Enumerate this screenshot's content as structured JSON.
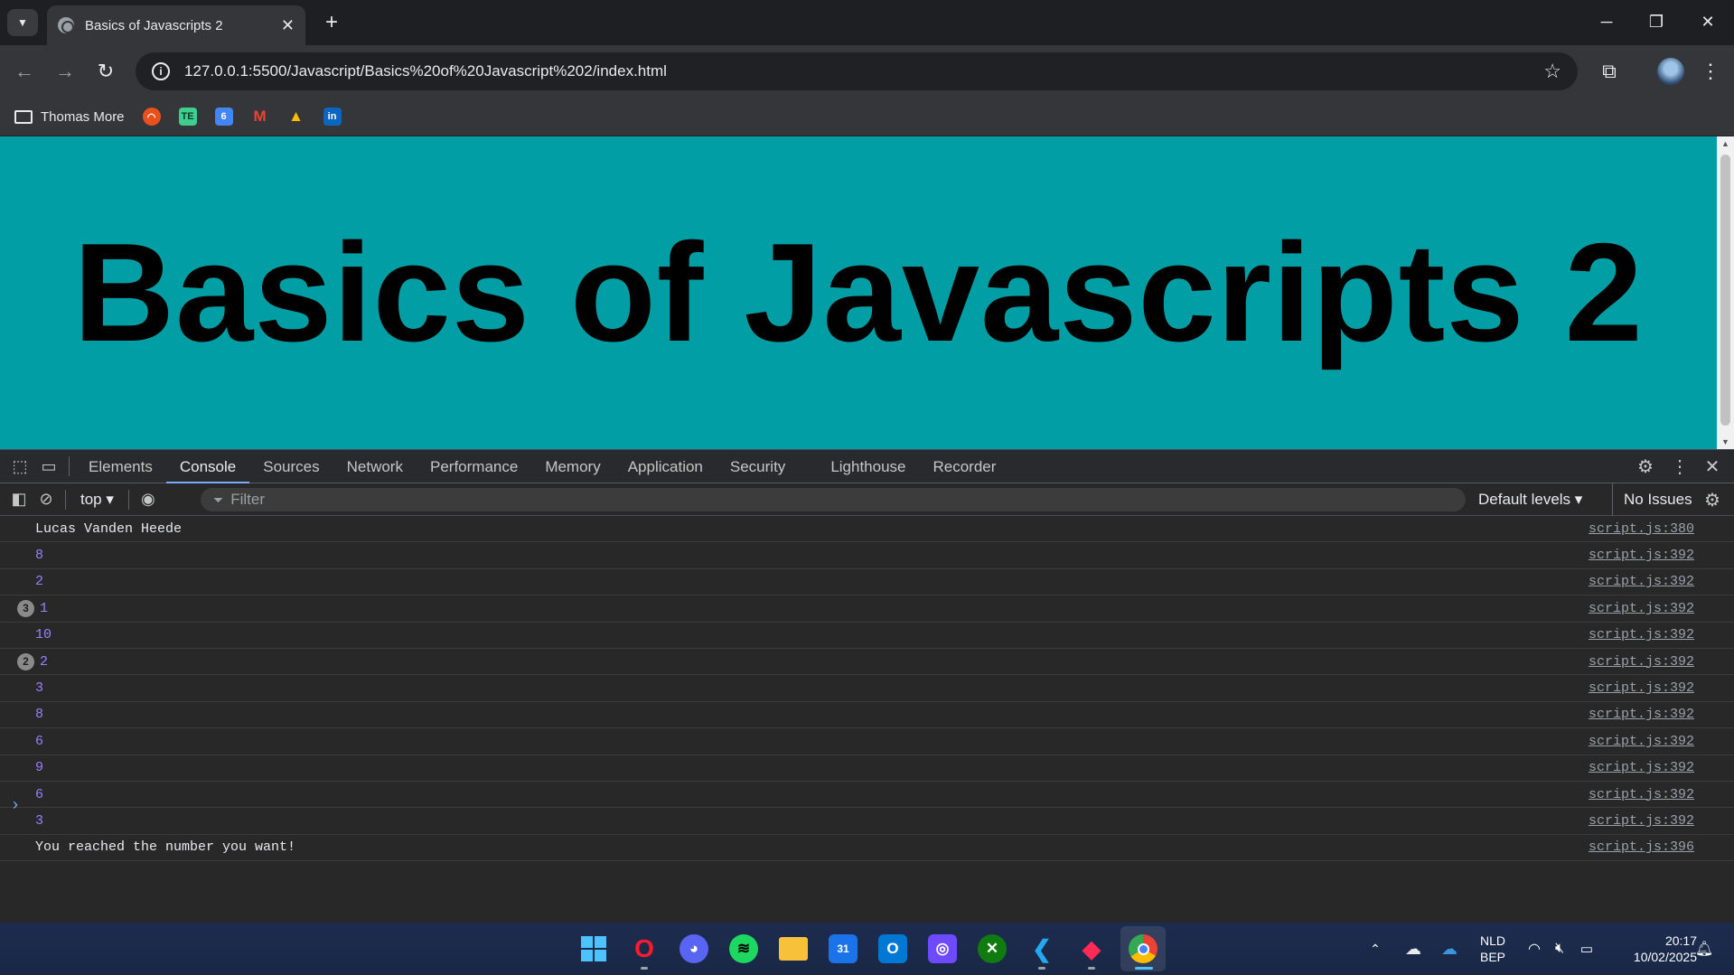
{
  "browser": {
    "tab_title": "Basics of Javascripts 2",
    "new_tab": "+",
    "close_tab": "✕",
    "url": "127.0.0.1:5500/Javascript/Basics%20of%20Javascript%202/index.html"
  },
  "bookmarks": {
    "folder_label": "Thomas More",
    "items": [
      "github-icon",
      "te-icon",
      "calendar-icon",
      "gmail-icon",
      "drive-icon",
      "linkedin-icon"
    ],
    "te_label": "TE",
    "cal_label": "6",
    "gmail_label": "M",
    "linkedin_label": "in"
  },
  "page": {
    "heading": "Basics of Javascripts 2",
    "background": "#019fa5"
  },
  "devtools": {
    "tabs": [
      "Elements",
      "Console",
      "Sources",
      "Network",
      "Performance",
      "Memory",
      "Application",
      "Security",
      "Lighthouse",
      "Recorder"
    ],
    "active_tab": "Console",
    "context": "top ▾",
    "filter_placeholder": "Filter",
    "levels": "Default levels ▾",
    "issues": "No Issues"
  },
  "console": {
    "rows": [
      {
        "text": "Lucas Vanden Heede",
        "src": "script.js:380",
        "kind": "str",
        "badge": ""
      },
      {
        "text": "8",
        "src": "script.js:392",
        "kind": "num",
        "badge": ""
      },
      {
        "text": "2",
        "src": "script.js:392",
        "kind": "num",
        "badge": ""
      },
      {
        "text": "1",
        "src": "script.js:392",
        "kind": "num",
        "badge": "3"
      },
      {
        "text": "10",
        "src": "script.js:392",
        "kind": "num",
        "badge": ""
      },
      {
        "text": "2",
        "src": "script.js:392",
        "kind": "num",
        "badge": "2"
      },
      {
        "text": "3",
        "src": "script.js:392",
        "kind": "num",
        "badge": ""
      },
      {
        "text": "8",
        "src": "script.js:392",
        "kind": "num",
        "badge": ""
      },
      {
        "text": "6",
        "src": "script.js:392",
        "kind": "num",
        "badge": ""
      },
      {
        "text": "9",
        "src": "script.js:392",
        "kind": "num",
        "badge": ""
      },
      {
        "text": "6",
        "src": "script.js:392",
        "kind": "num",
        "badge": ""
      },
      {
        "text": "3",
        "src": "script.js:392",
        "kind": "num",
        "badge": ""
      },
      {
        "text": "You reached the number you want!",
        "src": "script.js:396",
        "kind": "str",
        "badge": ""
      }
    ],
    "prompt": "›"
  },
  "taskbar": {
    "apps": [
      "windows-start-icon",
      "opera-icon",
      "discord-icon",
      "spotify-icon",
      "file-explorer-icon",
      "calendar-icon",
      "outlook-icon",
      "proton-icon",
      "xbox-icon",
      "vscode-icon",
      "pdf-icon",
      "chrome-icon"
    ],
    "lang_top": "NLD",
    "lang_bottom": "BEP",
    "time": "20:17",
    "date": "10/02/2025"
  }
}
